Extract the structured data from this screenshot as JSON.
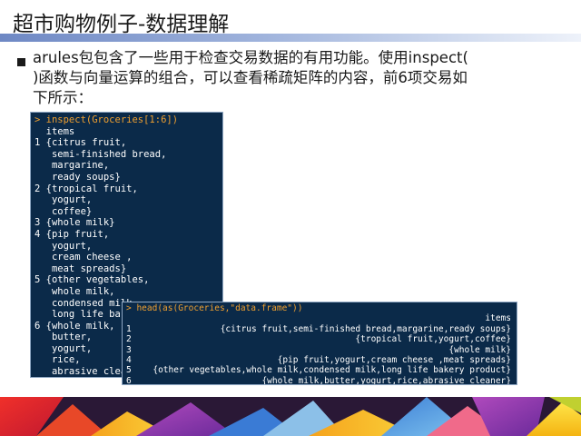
{
  "slide": {
    "title": "超市购物例子-数据理解",
    "bullet_text": "arules包包含了一些用于检查交易数据的有用功能。使用inspect( )函数与向量运算的组合，可以查看稀疏矩阵的内容，前6项交易如下所示："
  },
  "console_inspect": {
    "command": "> inspect(Groceries[1:6])",
    "lines": [
      "  items",
      "1 {citrus fruit,",
      "   semi-finished bread,",
      "   margarine,",
      "   ready soups}",
      "2 {tropical fruit,",
      "   yogurt,",
      "   coffee}",
      "3 {whole milk}",
      "4 {pip fruit,",
      "   yogurt,",
      "   cream cheese ,",
      "   meat spreads}",
      "5 {other vegetables,",
      "   whole milk,",
      "   condensed milk,",
      "   long life bakery product}",
      "6 {whole milk,",
      "   butter,",
      "   yogurt,",
      "   rice,",
      "   abrasive cleaner}"
    ]
  },
  "console_head": {
    "command": "> head(as(Groceries,\"data.frame\"))",
    "header": "items",
    "rows": [
      {
        "index": "1",
        "items": "{citrus fruit,semi-finished bread,margarine,ready soups}"
      },
      {
        "index": "2",
        "items": "{tropical fruit,yogurt,coffee}"
      },
      {
        "index": "3",
        "items": "{whole milk}"
      },
      {
        "index": "4",
        "items": "{pip fruit,yogurt,cream cheese ,meat spreads}"
      },
      {
        "index": "5",
        "items": "{other vegetables,whole milk,condensed milk,long life bakery product}"
      },
      {
        "index": "6",
        "items": "{whole milk,butter,yogurt,rice,abrasive cleaner}"
      }
    ]
  },
  "colors": {
    "console_bg": "#0b2a49",
    "prompt": "#f0a030",
    "title_bar": "#7d94cc"
  }
}
